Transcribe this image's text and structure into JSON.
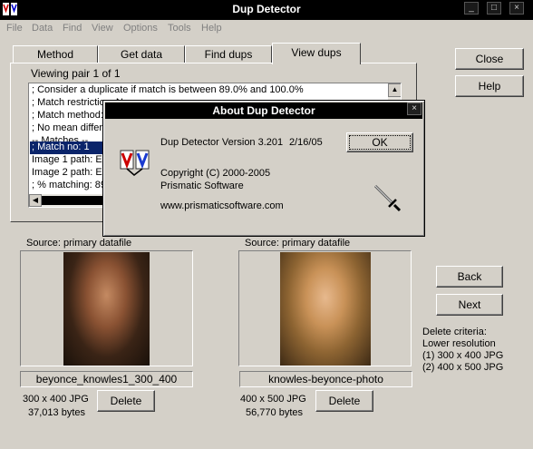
{
  "window": {
    "title": "Dup Detector",
    "controls": {
      "minimize": "_",
      "maximize": "□",
      "close": "×"
    }
  },
  "menu": [
    "File",
    "Data",
    "Find",
    "View",
    "Options",
    "Tools",
    "Help"
  ],
  "tabs": [
    "Method",
    "Get data",
    "Find dups",
    "View dups"
  ],
  "active_tab": "View dups",
  "side_buttons": {
    "close": "Close",
    "help": "Help"
  },
  "viewing": "Viewing pair 1 of 1",
  "listbox_lines": [
    "; Consider a duplicate if match is between 89.0% and 100.0%",
    "; Match restriction: N",
    "; Match method: ",
    "; No mean differ",
    "-- Matches --",
    "; Match no: 1",
    "Image 1 path: E:",
    "Image 2 path: E:",
    "; % matching: 89"
  ],
  "dialog": {
    "title": "About Dup Detector",
    "version": "Dup Detector Version 3.201",
    "date": "2/16/05",
    "ok": "OK",
    "copyright": "Copyright (C) 2000-2005",
    "company": "Prismatic Software",
    "url": "www.prismaticsoftware.com",
    "close": "×"
  },
  "image1": {
    "source": "Source: primary datafile",
    "filename": "beyonce_knowles1_300_400",
    "dims": "300 x 400 JPG",
    "bytes": "37,013 bytes",
    "delete": "Delete"
  },
  "image2": {
    "source": "Source: primary datafile",
    "filename": "knowles-beyonce-photo",
    "dims": "400 x 500 JPG",
    "bytes": "56,770 bytes",
    "delete": "Delete"
  },
  "nav": {
    "back": "Back",
    "next": "Next"
  },
  "criteria": {
    "title": "Delete criteria:",
    "line1": "Lower resolution",
    "line2": "(1) 300 x 400 JPG",
    "line3": "(2) 400 x 500 JPG"
  },
  "colors": {
    "face": "#d4d0c8",
    "titlebar": "#000000",
    "selection": "#0a246a"
  }
}
